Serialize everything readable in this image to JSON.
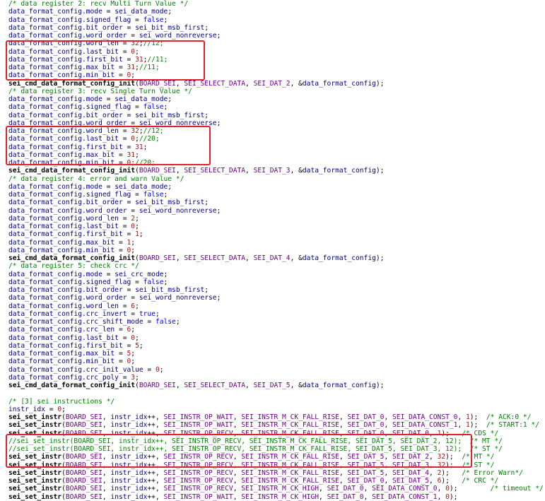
{
  "colors": {
    "comment": "#008000",
    "identifier": "#000080",
    "function": "#000000",
    "macro": "#6f008a",
    "number": "#a31515",
    "keyword": "#0000ff",
    "default": "#000000",
    "highlight_box": "#e0202a"
  },
  "code_lines": [
    [
      [
        "c",
        "/* data register 2: recv Multi Turn Value */"
      ]
    ],
    [
      [
        "v",
        "data_format_config.mode"
      ],
      [
        "d",
        " = "
      ],
      [
        "v",
        "sei_data_mode"
      ],
      [
        "d",
        ";"
      ]
    ],
    [
      [
        "v",
        "data_format_config.signed_flag"
      ],
      [
        "d",
        " = "
      ],
      [
        "k",
        "false"
      ],
      [
        "d",
        ";"
      ]
    ],
    [
      [
        "v",
        "data_format_config.bit_order"
      ],
      [
        "d",
        " = "
      ],
      [
        "v",
        "sei_bit_msb_first"
      ],
      [
        "d",
        ";"
      ]
    ],
    [
      [
        "v",
        "data_format_config.word_order"
      ],
      [
        "d",
        " = "
      ],
      [
        "v",
        "sei_word_nonreverse"
      ],
      [
        "d",
        ";"
      ]
    ],
    [
      [
        "v",
        "data_format_config.word_len"
      ],
      [
        "d",
        " = "
      ],
      [
        "n",
        "32"
      ],
      [
        "d",
        ";"
      ],
      [
        "c",
        "//12;"
      ]
    ],
    [
      [
        "v",
        "data_format_config.last_bit"
      ],
      [
        "d",
        " = "
      ],
      [
        "n",
        "0"
      ],
      [
        "d",
        ";"
      ]
    ],
    [
      [
        "v",
        "data_format_config.first_bit"
      ],
      [
        "d",
        " = "
      ],
      [
        "n",
        "31"
      ],
      [
        "d",
        ";"
      ],
      [
        "c",
        "//11;"
      ]
    ],
    [
      [
        "v",
        "data_format_config.max_bit"
      ],
      [
        "d",
        " = "
      ],
      [
        "n",
        "31"
      ],
      [
        "d",
        ";"
      ],
      [
        "c",
        "//11;"
      ]
    ],
    [
      [
        "v",
        "data_format_config.min_bit"
      ],
      [
        "d",
        " = "
      ],
      [
        "n",
        "0"
      ],
      [
        "d",
        ";"
      ]
    ],
    [
      [
        "f",
        "sei_cmd_data_format_config_init"
      ],
      [
        "d",
        "("
      ],
      [
        "m",
        "BOARD_SEI"
      ],
      [
        "d",
        ", "
      ],
      [
        "m",
        "SEI_SELECT_DATA"
      ],
      [
        "d",
        ", "
      ],
      [
        "m",
        "SEI_DAT_2"
      ],
      [
        "d",
        ", &"
      ],
      [
        "v",
        "data_format_config"
      ],
      [
        "d",
        ");"
      ]
    ],
    [
      [
        "c",
        "/* data register 3: recv Single Turn Value */"
      ]
    ],
    [
      [
        "v",
        "data_format_config.mode"
      ],
      [
        "d",
        " = "
      ],
      [
        "v",
        "sei_data_mode"
      ],
      [
        "d",
        ";"
      ]
    ],
    [
      [
        "v",
        "data_format_config.signed_flag"
      ],
      [
        "d",
        " = "
      ],
      [
        "k",
        "false"
      ],
      [
        "d",
        ";"
      ]
    ],
    [
      [
        "v",
        "data_format_config.bit_order"
      ],
      [
        "d",
        " = "
      ],
      [
        "v",
        "sei_bit_msb_first"
      ],
      [
        "d",
        ";"
      ]
    ],
    [
      [
        "v",
        "data_format_config.word_order"
      ],
      [
        "d",
        " = "
      ],
      [
        "v",
        "sei_word_nonreverse"
      ],
      [
        "d",
        ";"
      ]
    ],
    [
      [
        "v",
        "data_format_config.word_len"
      ],
      [
        "d",
        " = "
      ],
      [
        "n",
        "32"
      ],
      [
        "d",
        ";"
      ],
      [
        "c",
        "//12;"
      ]
    ],
    [
      [
        "v",
        "data_format_config.last_bit"
      ],
      [
        "d",
        " = "
      ],
      [
        "n",
        "0"
      ],
      [
        "d",
        ";"
      ],
      [
        "c",
        "//20;"
      ]
    ],
    [
      [
        "v",
        "data_format_config.first_bit"
      ],
      [
        "d",
        " = "
      ],
      [
        "n",
        "31"
      ],
      [
        "d",
        ";"
      ]
    ],
    [
      [
        "v",
        "data_format_config.max_bit"
      ],
      [
        "d",
        " = "
      ],
      [
        "n",
        "31"
      ],
      [
        "d",
        ";"
      ]
    ],
    [
      [
        "v",
        "data_format_config.min_bit"
      ],
      [
        "d",
        " = "
      ],
      [
        "n",
        "0"
      ],
      [
        "d",
        ";"
      ],
      [
        "c",
        "//20;"
      ]
    ],
    [
      [
        "f",
        "sei_cmd_data_format_config_init"
      ],
      [
        "d",
        "("
      ],
      [
        "m",
        "BOARD_SEI"
      ],
      [
        "d",
        ", "
      ],
      [
        "m",
        "SEI_SELECT_DATA"
      ],
      [
        "d",
        ", "
      ],
      [
        "m",
        "SEI_DAT_3"
      ],
      [
        "d",
        ", &"
      ],
      [
        "v",
        "data_format_config"
      ],
      [
        "d",
        ");"
      ]
    ],
    [
      [
        "c",
        "/* data register 4: error and warn Value */"
      ]
    ],
    [
      [
        "v",
        "data_format_config.mode"
      ],
      [
        "d",
        " = "
      ],
      [
        "v",
        "sei_data_mode"
      ],
      [
        "d",
        ";"
      ]
    ],
    [
      [
        "v",
        "data_format_config.signed_flag"
      ],
      [
        "d",
        " = "
      ],
      [
        "k",
        "false"
      ],
      [
        "d",
        ";"
      ]
    ],
    [
      [
        "v",
        "data_format_config.bit_order"
      ],
      [
        "d",
        " = "
      ],
      [
        "v",
        "sei_bit_msb_first"
      ],
      [
        "d",
        ";"
      ]
    ],
    [
      [
        "v",
        "data_format_config.word_order"
      ],
      [
        "d",
        " = "
      ],
      [
        "v",
        "sei_word_nonreverse"
      ],
      [
        "d",
        ";"
      ]
    ],
    [
      [
        "v",
        "data_format_config.word_len"
      ],
      [
        "d",
        " = "
      ],
      [
        "n",
        "2"
      ],
      [
        "d",
        ";"
      ]
    ],
    [
      [
        "v",
        "data_format_config.last_bit"
      ],
      [
        "d",
        " = "
      ],
      [
        "n",
        "0"
      ],
      [
        "d",
        ";"
      ]
    ],
    [
      [
        "v",
        "data_format_config.first_bit"
      ],
      [
        "d",
        " = "
      ],
      [
        "n",
        "1"
      ],
      [
        "d",
        ";"
      ]
    ],
    [
      [
        "v",
        "data_format_config.max_bit"
      ],
      [
        "d",
        " = "
      ],
      [
        "n",
        "1"
      ],
      [
        "d",
        ";"
      ]
    ],
    [
      [
        "v",
        "data_format_config.min_bit"
      ],
      [
        "d",
        " = "
      ],
      [
        "n",
        "0"
      ],
      [
        "d",
        ";"
      ]
    ],
    [
      [
        "f",
        "sei_cmd_data_format_config_init"
      ],
      [
        "d",
        "("
      ],
      [
        "m",
        "BOARD_SEI"
      ],
      [
        "d",
        ", "
      ],
      [
        "m",
        "SEI_SELECT_DATA"
      ],
      [
        "d",
        ", "
      ],
      [
        "m",
        "SEI_DAT_4"
      ],
      [
        "d",
        ", &"
      ],
      [
        "v",
        "data_format_config"
      ],
      [
        "d",
        ");"
      ]
    ],
    [
      [
        "c",
        "/* data register 5: check crc */"
      ]
    ],
    [
      [
        "v",
        "data_format_config.mode"
      ],
      [
        "d",
        " = "
      ],
      [
        "v",
        "sei_crc_mode"
      ],
      [
        "d",
        ";"
      ]
    ],
    [
      [
        "v",
        "data_format_config.signed_flag"
      ],
      [
        "d",
        " = "
      ],
      [
        "k",
        "false"
      ],
      [
        "d",
        ";"
      ]
    ],
    [
      [
        "v",
        "data_format_config.bit_order"
      ],
      [
        "d",
        " = "
      ],
      [
        "v",
        "sei_bit_msb_first"
      ],
      [
        "d",
        ";"
      ]
    ],
    [
      [
        "v",
        "data_format_config.word_order"
      ],
      [
        "d",
        " = "
      ],
      [
        "v",
        "sei_word_nonreverse"
      ],
      [
        "d",
        ";"
      ]
    ],
    [
      [
        "v",
        "data_format_config.word_len"
      ],
      [
        "d",
        " = "
      ],
      [
        "n",
        "6"
      ],
      [
        "d",
        ";"
      ]
    ],
    [
      [
        "v",
        "data_format_config.crc_invert"
      ],
      [
        "d",
        " = "
      ],
      [
        "k",
        "true"
      ],
      [
        "d",
        ";"
      ]
    ],
    [
      [
        "v",
        "data_format_config.crc_shift_mode"
      ],
      [
        "d",
        " = "
      ],
      [
        "k",
        "false"
      ],
      [
        "d",
        ";"
      ]
    ],
    [
      [
        "v",
        "data_format_config.crc_len"
      ],
      [
        "d",
        " = "
      ],
      [
        "n",
        "6"
      ],
      [
        "d",
        ";"
      ]
    ],
    [
      [
        "v",
        "data_format_config.last_bit"
      ],
      [
        "d",
        " = "
      ],
      [
        "n",
        "0"
      ],
      [
        "d",
        ";"
      ]
    ],
    [
      [
        "v",
        "data_format_config.first_bit"
      ],
      [
        "d",
        " = "
      ],
      [
        "n",
        "5"
      ],
      [
        "d",
        ";"
      ]
    ],
    [
      [
        "v",
        "data_format_config.max_bit"
      ],
      [
        "d",
        " = "
      ],
      [
        "n",
        "5"
      ],
      [
        "d",
        ";"
      ]
    ],
    [
      [
        "v",
        "data_format_config.min_bit"
      ],
      [
        "d",
        " = "
      ],
      [
        "n",
        "0"
      ],
      [
        "d",
        ";"
      ]
    ],
    [
      [
        "v",
        "data_format_config.crc_init_value"
      ],
      [
        "d",
        " = "
      ],
      [
        "n",
        "0"
      ],
      [
        "d",
        ";"
      ]
    ],
    [
      [
        "v",
        "data_format_config.crc_poly"
      ],
      [
        "d",
        " = "
      ],
      [
        "n",
        "3"
      ],
      [
        "d",
        ";"
      ]
    ],
    [
      [
        "f",
        "sei_cmd_data_format_config_init"
      ],
      [
        "d",
        "("
      ],
      [
        "m",
        "BOARD_SEI"
      ],
      [
        "d",
        ", "
      ],
      [
        "m",
        "SEI_SELECT_DATA"
      ],
      [
        "d",
        ", "
      ],
      [
        "m",
        "SEI_DAT_5"
      ],
      [
        "d",
        ", &"
      ],
      [
        "v",
        "data_format_config"
      ],
      [
        "d",
        ");"
      ]
    ],
    [],
    [
      [
        "c",
        "/* [3] sei instructions */"
      ]
    ],
    [
      [
        "v",
        "instr_idx"
      ],
      [
        "d",
        " = "
      ],
      [
        "n",
        "0"
      ],
      [
        "d",
        ";"
      ]
    ],
    [
      [
        "f",
        "sei_set_instr"
      ],
      [
        "d",
        "("
      ],
      [
        "m",
        "BOARD_SEI"
      ],
      [
        "d",
        ", "
      ],
      [
        "v",
        "instr_idx"
      ],
      [
        "d",
        "++, "
      ],
      [
        "m",
        "SEI_INSTR_OP_WAIT"
      ],
      [
        "d",
        ", "
      ],
      [
        "m",
        "SEI_INSTR_M_CK_FALL_RISE"
      ],
      [
        "d",
        ", "
      ],
      [
        "m",
        "SEI_DAT_0"
      ],
      [
        "d",
        ", "
      ],
      [
        "m",
        "SEI_DATA_CONST_0"
      ],
      [
        "d",
        ", "
      ],
      [
        "n",
        "1"
      ],
      [
        "d",
        ");  "
      ],
      [
        "c",
        "/* ACK:0 */"
      ]
    ],
    [
      [
        "f",
        "sei_set_instr"
      ],
      [
        "d",
        "("
      ],
      [
        "m",
        "BOARD_SEI"
      ],
      [
        "d",
        ", "
      ],
      [
        "v",
        "instr_idx"
      ],
      [
        "d",
        "++, "
      ],
      [
        "m",
        "SEI_INSTR_OP_WAIT"
      ],
      [
        "d",
        ", "
      ],
      [
        "m",
        "SEI_INSTR_M_CK_FALL_RISE"
      ],
      [
        "d",
        ", "
      ],
      [
        "m",
        "SEI_DAT_0"
      ],
      [
        "d",
        ", "
      ],
      [
        "m",
        "SEI_DATA_CONST_1"
      ],
      [
        "d",
        ", "
      ],
      [
        "n",
        "1"
      ],
      [
        "d",
        ");  "
      ],
      [
        "c",
        "/* START:1 */"
      ]
    ],
    [
      [
        "f",
        "sei_set_instr"
      ],
      [
        "d",
        "("
      ],
      [
        "m",
        "BOARD_SEI"
      ],
      [
        "d",
        ", "
      ],
      [
        "v",
        "instr_idx"
      ],
      [
        "d",
        "++, "
      ],
      [
        "m",
        "SEI_INSTR_OP_RECV"
      ],
      [
        "d",
        ", "
      ],
      [
        "m",
        "SEI_INSTR_M_CK_FALL_RISE"
      ],
      [
        "d",
        ", "
      ],
      [
        "m",
        "SEI_DAT_0"
      ],
      [
        "d",
        ", "
      ],
      [
        "m",
        "SEI_DAT_0"
      ],
      [
        "d",
        ", "
      ],
      [
        "n",
        "1"
      ],
      [
        "d",
        ");   "
      ],
      [
        "c",
        "/* CDS */"
      ]
    ],
    [
      [
        "c",
        "//sei_set_instr(BOARD_SEI, instr_idx++, SEI_INSTR_OP_RECV, SEI_INSTR_M_CK_FALL_RISE, SEI_DAT_5, SEI_DAT_2, 12);  /* MT */"
      ]
    ],
    [
      [
        "c",
        "//sei_set_instr(BOARD_SEI, instr_idx++, SEI_INSTR_OP_RECV, SEI_INSTR_M_CK_FALL_RISE, SEI_DAT_5, SEI_DAT_3, 12);  /* ST */"
      ]
    ],
    [
      [
        "f",
        "sei_set_instr"
      ],
      [
        "d",
        "("
      ],
      [
        "m",
        "BOARD_SEI"
      ],
      [
        "d",
        ", "
      ],
      [
        "v",
        "instr_idx"
      ],
      [
        "d",
        "++, "
      ],
      [
        "m",
        "SEI_INSTR_OP_RECV"
      ],
      [
        "d",
        ", "
      ],
      [
        "m",
        "SEI_INSTR_M_CK_FALL_RISE"
      ],
      [
        "d",
        ", "
      ],
      [
        "m",
        "SEI_DAT_5"
      ],
      [
        "d",
        ", "
      ],
      [
        "m",
        "SEI_DAT_2"
      ],
      [
        "d",
        ", "
      ],
      [
        "n",
        "32"
      ],
      [
        "d",
        ");  "
      ],
      [
        "c",
        "/* MT */"
      ]
    ],
    [
      [
        "f",
        "sei_set_instr"
      ],
      [
        "d",
        "("
      ],
      [
        "m",
        "BOARD_SEI"
      ],
      [
        "d",
        ", "
      ],
      [
        "v",
        "instr_idx"
      ],
      [
        "d",
        "++, "
      ],
      [
        "m",
        "SEI_INSTR_OP_RECV"
      ],
      [
        "d",
        ", "
      ],
      [
        "m",
        "SEI_INSTR_M_CK_FALL_RISE"
      ],
      [
        "d",
        ", "
      ],
      [
        "m",
        "SEI_DAT_5"
      ],
      [
        "d",
        ", "
      ],
      [
        "m",
        "SEI_DAT_3"
      ],
      [
        "d",
        ", "
      ],
      [
        "n",
        "32"
      ],
      [
        "d",
        ");  "
      ],
      [
        "c",
        "/* ST */"
      ]
    ],
    [
      [
        "f",
        "sei_set_instr"
      ],
      [
        "d",
        "("
      ],
      [
        "m",
        "BOARD_SEI"
      ],
      [
        "d",
        ", "
      ],
      [
        "v",
        "instr_idx"
      ],
      [
        "d",
        "++, "
      ],
      [
        "m",
        "SEI_INSTR_OP_RECV"
      ],
      [
        "d",
        ", "
      ],
      [
        "m",
        "SEI_INSTR_M_CK_FALL_RISE"
      ],
      [
        "d",
        ", "
      ],
      [
        "m",
        "SEI_DAT_5"
      ],
      [
        "d",
        ", "
      ],
      [
        "m",
        "SEI_DAT_4"
      ],
      [
        "d",
        ", "
      ],
      [
        "n",
        "2"
      ],
      [
        "d",
        ");   "
      ],
      [
        "c",
        "/* Error Warn*/"
      ]
    ],
    [
      [
        "f",
        "sei_set_instr"
      ],
      [
        "d",
        "("
      ],
      [
        "m",
        "BOARD_SEI"
      ],
      [
        "d",
        ", "
      ],
      [
        "v",
        "instr_idx"
      ],
      [
        "d",
        "++, "
      ],
      [
        "m",
        "SEI_INSTR_OP_RECV"
      ],
      [
        "d",
        ", "
      ],
      [
        "m",
        "SEI_INSTR_M_CK_FALL_RISE"
      ],
      [
        "d",
        ", "
      ],
      [
        "m",
        "SEI_DAT_0"
      ],
      [
        "d",
        ", "
      ],
      [
        "m",
        "SEI_DAT_5"
      ],
      [
        "d",
        ", "
      ],
      [
        "n",
        "6"
      ],
      [
        "d",
        ");   "
      ],
      [
        "c",
        "/* CRC */"
      ]
    ],
    [
      [
        "f",
        "sei_set_instr"
      ],
      [
        "d",
        "("
      ],
      [
        "m",
        "BOARD_SEI"
      ],
      [
        "d",
        ", "
      ],
      [
        "v",
        "instr_idx"
      ],
      [
        "d",
        "++, "
      ],
      [
        "m",
        "SEI_INSTR_OP_RECV"
      ],
      [
        "d",
        ", "
      ],
      [
        "m",
        "SEI_INSTR_M_CK_HIGH"
      ],
      [
        "d",
        ", "
      ],
      [
        "m",
        "SEI_DAT_0"
      ],
      [
        "d",
        ", "
      ],
      [
        "m",
        "SEI_DATA_CONST_0"
      ],
      [
        "d",
        ", "
      ],
      [
        "n",
        "0"
      ],
      [
        "d",
        ");        "
      ],
      [
        "c",
        "/* timeout */"
      ]
    ],
    [
      [
        "f",
        "sei_set_instr"
      ],
      [
        "d",
        "("
      ],
      [
        "m",
        "BOARD_SEI"
      ],
      [
        "d",
        ", "
      ],
      [
        "v",
        "instr_idx"
      ],
      [
        "d",
        "++, "
      ],
      [
        "m",
        "SEI_INSTR_OP_WAIT"
      ],
      [
        "d",
        ", "
      ],
      [
        "m",
        "SEI_INSTR_M_CK_HIGH"
      ],
      [
        "d",
        ", "
      ],
      [
        "m",
        "SEI_DAT_0"
      ],
      [
        "d",
        ", "
      ],
      [
        "m",
        "SEI_DATA_CONST_1"
      ],
      [
        "d",
        ", "
      ],
      [
        "n",
        "0"
      ],
      [
        "d",
        ");"
      ]
    ]
  ]
}
